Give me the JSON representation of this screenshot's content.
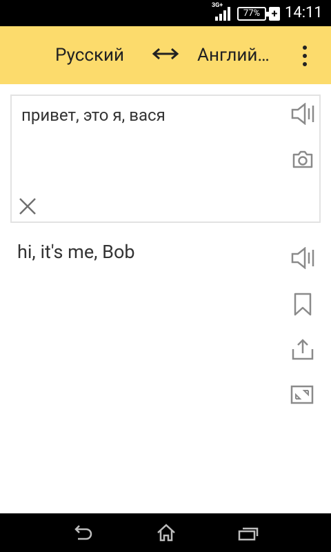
{
  "status": {
    "network": "3G+",
    "battery": "77%",
    "charging": "+",
    "time": "14:11"
  },
  "toolbar": {
    "source_lang": "Русский",
    "target_lang": "Английский",
    "swap_icon": "double-arrow-icon",
    "menu_icon": "overflow-menu-icon"
  },
  "input": {
    "text": "привет, это я, вася",
    "icons": [
      "speaker-icon",
      "camera-icon",
      "clear-icon"
    ]
  },
  "output": {
    "text": "hi, it's me, Bob",
    "icons": [
      "speaker-icon",
      "bookmark-icon",
      "share-icon",
      "fullscreen-icon"
    ]
  },
  "navigation": {
    "icons": [
      "back-icon",
      "home-icon",
      "recent-apps-icon"
    ]
  },
  "colors": {
    "toolbar_bg": "#fcdb6c",
    "icon_gray": "#8a8a8a",
    "text": "#333333"
  }
}
